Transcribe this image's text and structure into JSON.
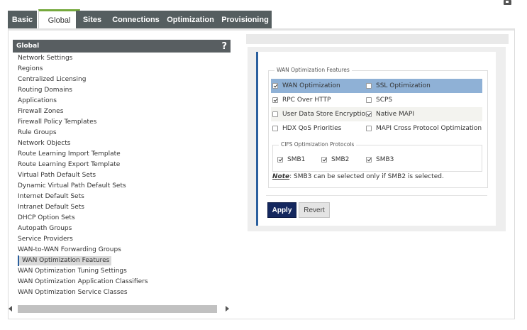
{
  "tabs": [
    {
      "label": "Basic",
      "active": false
    },
    {
      "label": "Global",
      "active": true
    },
    {
      "label": "Sites",
      "active": false
    },
    {
      "label": "Connections",
      "active": false
    },
    {
      "label": "Optimization",
      "active": false
    },
    {
      "label": "Provisioning",
      "active": false
    }
  ],
  "nav": {
    "title": "Global",
    "help": "?",
    "items": [
      "Network Settings",
      "Regions",
      "Centralized Licensing",
      "Routing Domains",
      "Applications",
      "Firewall Zones",
      "Firewall Policy Templates",
      "Rule Groups",
      "Network Objects",
      "Route Learning Import Template",
      "Route Learning Export Template",
      "Virtual Path Default Sets",
      "Dynamic Virtual Path Default Sets",
      "Internet Default Sets",
      "Intranet Default Sets",
      "DHCP Option Sets",
      "Autopath Groups",
      "Service Providers",
      "WAN-to-WAN Forwarding Groups",
      "WAN Optimization Features",
      "WAN Optimization Tuning Settings",
      "WAN Optimization Application Classifiers",
      "WAN Optimization Service Classes"
    ],
    "selected_index": 19
  },
  "form": {
    "legend": "WAN Optimization Features",
    "options": [
      [
        {
          "label": "WAN Optimization",
          "checked": true
        },
        {
          "label": "SSL Optimization",
          "checked": false
        }
      ],
      [
        {
          "label": "RPC Over HTTP",
          "checked": true
        },
        {
          "label": "SCPS",
          "checked": false
        }
      ],
      [
        {
          "label": "User Data Store Encryption",
          "checked": false
        },
        {
          "label": "Native MAPI",
          "checked": true
        }
      ],
      [
        {
          "label": "HDX QoS Priorities",
          "checked": false
        },
        {
          "label": "MAPI Cross Protocol Optimization",
          "checked": false
        }
      ]
    ],
    "cifs": {
      "legend": "CIFS Optimization Protocols",
      "options": [
        {
          "label": "SMB1",
          "checked": true
        },
        {
          "label": "SMB2",
          "checked": true
        },
        {
          "label": "SMB3",
          "checked": true
        }
      ]
    },
    "note_label": "Note",
    "note_text": ": SMB3 can be selected only if SMB2 is selected.",
    "apply_label": "Apply",
    "revert_label": "Revert"
  },
  "colors": {
    "tab_bg": "#555e60",
    "active_tab_accent": "#74a83c",
    "nav_header_bg": "#585e61",
    "highlight_row": "#8fb1d6",
    "apply_bg": "#14275e",
    "panel_accent": "#2a5f9e"
  }
}
